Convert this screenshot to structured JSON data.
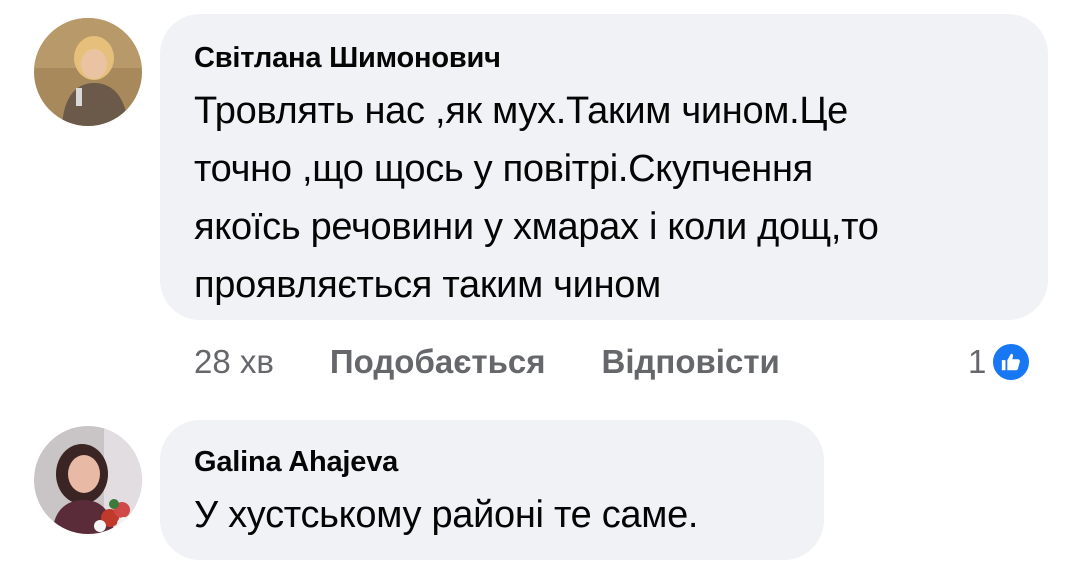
{
  "comments": [
    {
      "author": "Світлана Шимонович",
      "text": "Тровлять нас ,як мух.Таким чином.Це\nточно ,що щось у повітрі.Скупчення\nякоїсь речовини у хмарах і коли дощ,то\nпроявляється таким чином",
      "time": "28 хв",
      "like_label": "Подобається",
      "reply_label": "Відповісти",
      "reaction_count": "1",
      "reaction_icon": "like-icon",
      "reaction_color": "#1877f2"
    },
    {
      "author": "Galina Ahajeva",
      "text": "У хустському районі те саме."
    }
  ],
  "colors": {
    "bubble": "#f0f2f5",
    "text": "#050505",
    "meta": "#65676b",
    "accent": "#1877f2"
  }
}
